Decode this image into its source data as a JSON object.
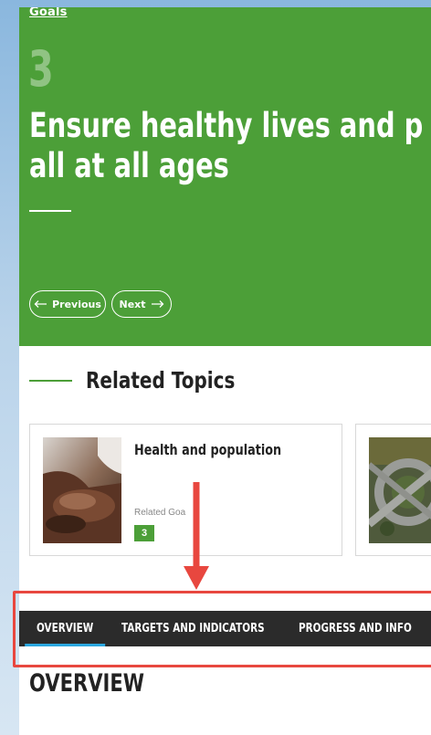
{
  "breadcrumb": "Goals",
  "goal": {
    "number": "3",
    "title_line1": "Ensure healthy lives and p",
    "title_line2": "all at all ages"
  },
  "nav": {
    "previous": "Previous",
    "next": "Next"
  },
  "related": {
    "heading": "Related Topics",
    "cards": [
      {
        "title": "Health and population",
        "related_label": "Related Goa",
        "goal_badge": "3"
      }
    ]
  },
  "tabs": [
    {
      "label": "OVERVIEW",
      "active": true
    },
    {
      "label": "TARGETS AND INDICATORS",
      "active": false
    },
    {
      "label": "PROGRESS AND INFO",
      "active": false
    }
  ],
  "section_heading": "OVERVIEW",
  "colors": {
    "goal_green": "#4c9f38",
    "tab_bar": "#2b2b2b",
    "tab_active": "#2aa7df",
    "annotation": "#e8473f"
  }
}
